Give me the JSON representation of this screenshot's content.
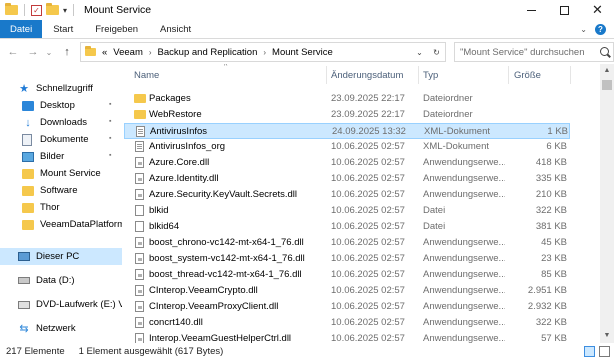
{
  "window": {
    "title": "Mount Service",
    "minimize_glyph": "—",
    "maximize_glyph": "☐",
    "close_glyph": "✕"
  },
  "quick_access_toolbar": {
    "icons": [
      "folder-icon",
      "properties-icon",
      "new-folder-icon",
      "customize-dropdown-icon"
    ],
    "dropdown_glyph": "▾"
  },
  "ribbon": {
    "tabs": [
      {
        "label": "Datei",
        "active": true
      },
      {
        "label": "Start"
      },
      {
        "label": "Freigeben"
      },
      {
        "label": "Ansicht"
      }
    ],
    "expand_glyph": "⌄",
    "help_glyph": "?"
  },
  "navigation": {
    "back_glyph": "←",
    "forward_glyph": "→",
    "recent_glyph": "⌄",
    "up_glyph": "↑"
  },
  "address": {
    "overflow": "«",
    "crumbs": [
      "Veeam",
      "Backup and Replication",
      "Mount Service"
    ],
    "separator": "›",
    "dropdown_glyph": "⌄",
    "refresh_glyph": "↻"
  },
  "search": {
    "placeholder": "\"Mount Service\" durchsuchen"
  },
  "nav_pane": {
    "items": [
      {
        "label": "Schnellzugriff",
        "icon": "star-icon",
        "pinned": false
      },
      {
        "label": "Desktop",
        "icon": "desktop-icon",
        "pinned": true
      },
      {
        "label": "Downloads",
        "icon": "download-icon",
        "pinned": true
      },
      {
        "label": "Dokumente",
        "icon": "documents-icon",
        "pinned": true
      },
      {
        "label": "Bilder",
        "icon": "pictures-icon",
        "pinned": true
      },
      {
        "label": "Mount Service",
        "icon": "folder-icon",
        "pinned": false
      },
      {
        "label": "Software",
        "icon": "folder-icon",
        "pinned": false
      },
      {
        "label": "Thor",
        "icon": "folder-icon",
        "pinned": false
      },
      {
        "label": "VeeamDataPlatform",
        "icon": "folder-icon",
        "pinned": false
      },
      {
        "label": "Dieser PC",
        "icon": "computer-icon",
        "pinned": false,
        "selected": true
      },
      {
        "label": "Data (D:)",
        "icon": "drive-icon",
        "pinned": false
      },
      {
        "label": "DVD-Laufwerk (E:) Ve",
        "icon": "dvd-drive-icon",
        "pinned": false
      },
      {
        "label": "Netzwerk",
        "icon": "network-icon",
        "pinned": false
      }
    ],
    "pin_glyph": "📌"
  },
  "columns": {
    "name": "Name",
    "modified": "Änderungsdatum",
    "type": "Typ",
    "size": "Größe",
    "sort_glyph": "^"
  },
  "files": [
    {
      "name": "Packages",
      "date": "23.09.2025 22:17",
      "type": "Dateiordner",
      "size": "",
      "kind": "folder"
    },
    {
      "name": "WebRestore",
      "date": "23.09.2025 22:17",
      "type": "Dateiordner",
      "size": "",
      "kind": "folder"
    },
    {
      "name": "AntivirusInfos",
      "date": "24.09.2025 13:32",
      "type": "XML-Dokument",
      "size": "1 KB",
      "kind": "xml",
      "selected": true
    },
    {
      "name": "AntivirusInfos_org",
      "date": "10.06.2025 02:57",
      "type": "XML-Dokument",
      "size": "6 KB",
      "kind": "xml"
    },
    {
      "name": "Azure.Core.dll",
      "date": "10.06.2025 02:57",
      "type": "Anwendungserwe...",
      "size": "418 KB",
      "kind": "dll"
    },
    {
      "name": "Azure.Identity.dll",
      "date": "10.06.2025 02:57",
      "type": "Anwendungserwe...",
      "size": "335 KB",
      "kind": "dll"
    },
    {
      "name": "Azure.Security.KeyVault.Secrets.dll",
      "date": "10.06.2025 02:57",
      "type": "Anwendungserwe...",
      "size": "210 KB",
      "kind": "dll"
    },
    {
      "name": "blkid",
      "date": "10.06.2025 02:57",
      "type": "Datei",
      "size": "322 KB",
      "kind": "file"
    },
    {
      "name": "blkid64",
      "date": "10.06.2025 02:57",
      "type": "Datei",
      "size": "381 KB",
      "kind": "file"
    },
    {
      "name": "boost_chrono-vc142-mt-x64-1_76.dll",
      "date": "10.06.2025 02:57",
      "type": "Anwendungserwe...",
      "size": "45 KB",
      "kind": "dll"
    },
    {
      "name": "boost_system-vc142-mt-x64-1_76.dll",
      "date": "10.06.2025 02:57",
      "type": "Anwendungserwe...",
      "size": "23 KB",
      "kind": "dll"
    },
    {
      "name": "boost_thread-vc142-mt-x64-1_76.dll",
      "date": "10.06.2025 02:57",
      "type": "Anwendungserwe...",
      "size": "85 KB",
      "kind": "dll"
    },
    {
      "name": "CInterop.VeeamCrypto.dll",
      "date": "10.06.2025 02:57",
      "type": "Anwendungserwe...",
      "size": "2.951 KB",
      "kind": "dll"
    },
    {
      "name": "CInterop.VeeamProxyClient.dll",
      "date": "10.06.2025 02:57",
      "type": "Anwendungserwe...",
      "size": "2.932 KB",
      "kind": "dll"
    },
    {
      "name": "concrt140.dll",
      "date": "10.06.2025 02:57",
      "type": "Anwendungserwe...",
      "size": "322 KB",
      "kind": "dll"
    },
    {
      "name": "Interop.VeeamGuestHelperCtrl.dll",
      "date": "10.06.2025 02:57",
      "type": "Anwendungserwe...",
      "size": "57 KB",
      "kind": "dll"
    }
  ],
  "status": {
    "count": "217 Elemente",
    "selection": "1 Element ausgewählt (617 Bytes)"
  },
  "scrollbar": {
    "up_glyph": "▲",
    "down_glyph": "▼"
  }
}
